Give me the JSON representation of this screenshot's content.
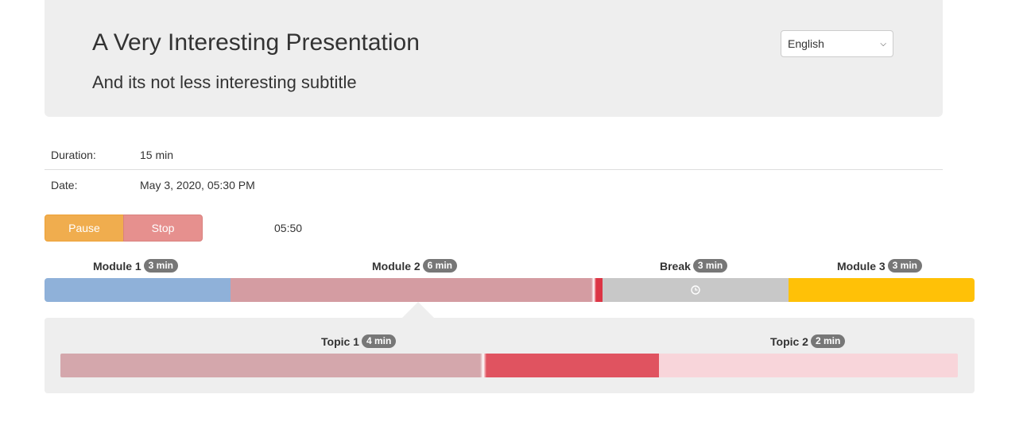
{
  "header": {
    "title": "A Very Interesting Presentation",
    "subtitle": "And its not less interesting subtitle",
    "language_selected": "English"
  },
  "info": {
    "duration_label": "Duration:",
    "duration_value": "15 min",
    "date_label": "Date:",
    "date_value": "May 3, 2020, 05:30 PM"
  },
  "controls": {
    "pause_label": "Pause",
    "stop_label": "Stop",
    "timer": "05:50"
  },
  "modules": [
    {
      "name": "Module 1",
      "duration": "3 min",
      "color": "#8fb1d9"
    },
    {
      "name": "Module 2",
      "duration": "6 min",
      "color": "#dc3545"
    },
    {
      "name": "Break",
      "duration": "3 min",
      "color": "#c8c8c8",
      "icon": "clock-icon"
    },
    {
      "name": "Module 3",
      "duration": "3 min",
      "color": "#ffc107"
    }
  ],
  "topics": [
    {
      "name": "Topic 1",
      "duration": "4 min",
      "color": "#e05360"
    },
    {
      "name": "Topic 2",
      "duration": "2 min",
      "color": "#f8d5da"
    }
  ]
}
